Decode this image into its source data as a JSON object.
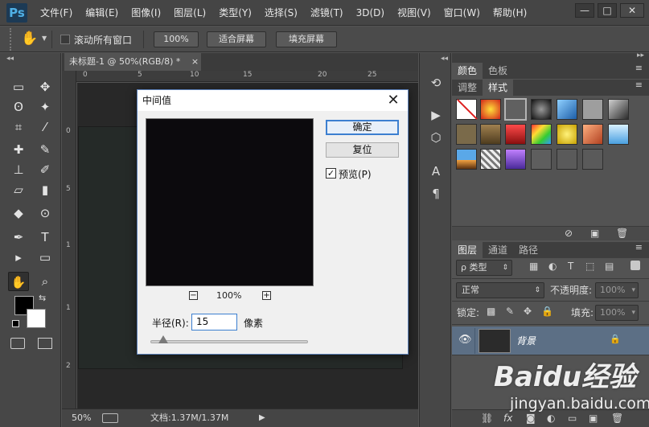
{
  "app": {
    "logo": "Ps"
  },
  "menu": [
    "文件(F)",
    "编辑(E)",
    "图像(I)",
    "图层(L)",
    "类型(Y)",
    "选择(S)",
    "滤镜(T)",
    "3D(D)",
    "视图(V)",
    "窗口(W)",
    "帮助(H)"
  ],
  "window_controls": {
    "minimize": "—",
    "maximize": "□",
    "close": "✕"
  },
  "options_bar": {
    "scroll_all_label": "滚动所有窗口",
    "zoom_100": "100%",
    "fit_screen": "适合屏幕",
    "fill_screen": "填充屏幕"
  },
  "document": {
    "tab_title": "未标题-1 @ 50%(RGB/8) *",
    "tab_close": "×",
    "ruler_top": [
      "0",
      "5",
      "10",
      "15",
      "20",
      "25"
    ],
    "ruler_left": [
      "0",
      "5",
      "1",
      "1",
      "2"
    ],
    "status_zoom": "50%",
    "status_doc": "文档:1.37M/1.37M"
  },
  "tools": [
    "▭",
    "✥",
    "ʘ",
    "✦",
    "⌗",
    "⁄",
    "✚",
    "✎",
    "⊥",
    "✐",
    "▱",
    "▮",
    "◆",
    "⊙",
    "✒",
    "T",
    "▸",
    "▭",
    "✋",
    "⌕"
  ],
  "colors": {
    "foreground": "#000000",
    "background": "#ffffff",
    "accent": "#3c7fd0"
  },
  "panel_color": {
    "tabs": [
      "颜色",
      "色板"
    ]
  },
  "panel_styles": {
    "tabs": [
      "调整",
      "样式"
    ]
  },
  "panel_layers": {
    "tabs": [
      "图层",
      "通道",
      "路径"
    ],
    "kind_filter": "ρ 类型",
    "blend_mode": "正常",
    "opacity_label": "不透明度:",
    "opacity_value": "100%",
    "lock_label": "锁定:",
    "fill_label": "填充:",
    "fill_value": "100%",
    "layer_name": "背景"
  },
  "dialog": {
    "title": "中间值",
    "close": "✕",
    "ok": "确定",
    "reset": "复位",
    "preview_label": "预览(P)",
    "preview_checked": "✓",
    "zoom_out": "−",
    "zoom_in": "+",
    "zoom_value": "100%",
    "radius_label": "半径(R):",
    "radius_value": "15",
    "unit": "像素",
    "radius_level": 0.08
  },
  "watermark": {
    "brand": "Baidu经验",
    "url": "jingyan.baidu.com"
  }
}
